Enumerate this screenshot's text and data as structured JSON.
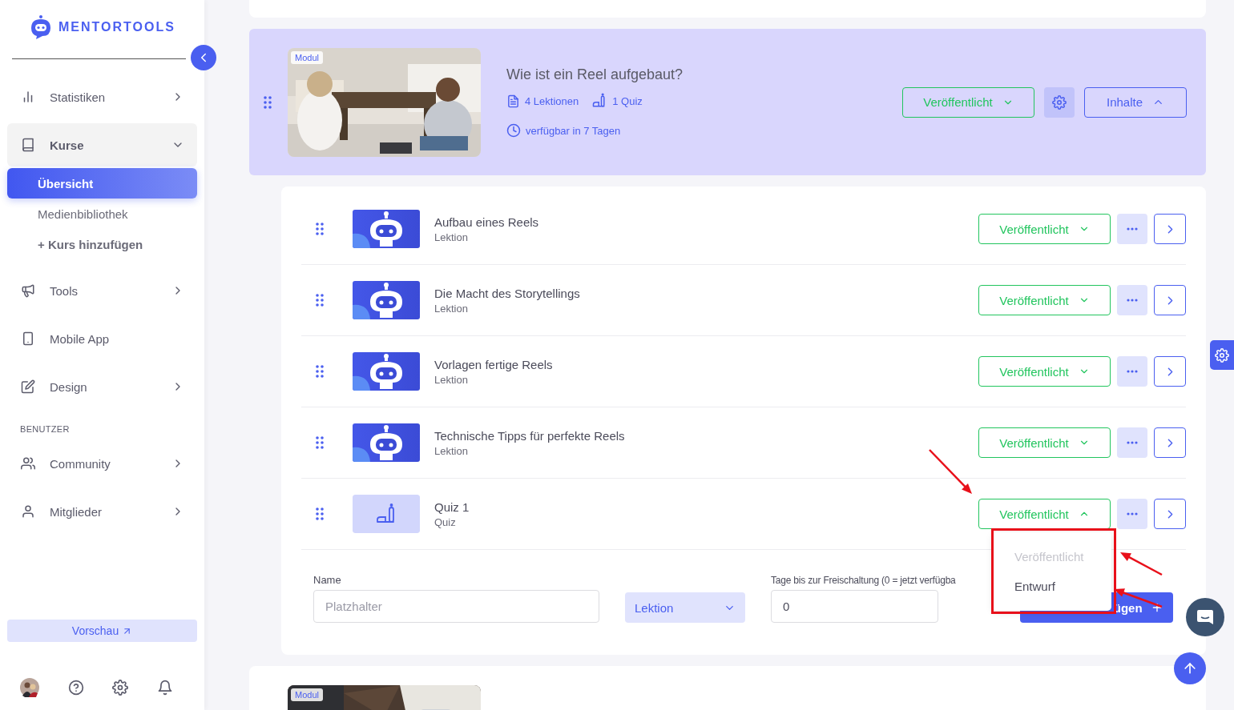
{
  "logo": {
    "text": "MENTORTOOLS"
  },
  "sidebar": {
    "items": [
      {
        "kind": "chart",
        "label": "Statistiken",
        "expandable": true,
        "expanded": false
      },
      {
        "kind": "book",
        "label": "Kurse",
        "expandable": true,
        "expanded": true,
        "children": [
          {
            "label": "Übersicht",
            "selected": true,
            "bold": false
          },
          {
            "label": "Medienbibliothek",
            "selected": false,
            "bold": false
          },
          {
            "label": "+ Kurs hinzufügen",
            "selected": false,
            "bold": true
          }
        ]
      },
      {
        "kind": "megaphone",
        "label": "Tools",
        "expandable": true,
        "expanded": false
      },
      {
        "kind": "phone",
        "label": "Mobile App",
        "expandable": false,
        "expanded": false
      },
      {
        "kind": "pen",
        "label": "Design",
        "expandable": true,
        "expanded": false
      },
      {
        "kind": "heading",
        "label": "BENUTZER"
      },
      {
        "kind": "people",
        "label": "Community",
        "expandable": true,
        "expanded": false
      },
      {
        "kind": "person",
        "label": "Mitglieder",
        "expandable": true,
        "expanded": false
      }
    ],
    "preview_button": "Vorschau"
  },
  "module": {
    "badge": "Modul",
    "title": "Wie ist ein Reel aufgebaut?",
    "lessons": "4 Lektionen",
    "quizzes": "1 Quiz",
    "availability": "verfügbar in 7 Tagen",
    "status": "Veröffentlicht",
    "contents_button": "Inhalte",
    "expanded": true
  },
  "rows": [
    {
      "kind": "lesson",
      "title": "Aufbau eines Reels",
      "type": "Lektion",
      "status": "Veröffentlicht",
      "menu_open": false
    },
    {
      "kind": "lesson",
      "title": "Die Macht des Storytellings",
      "type": "Lektion",
      "status": "Veröffentlicht",
      "menu_open": false
    },
    {
      "kind": "lesson",
      "title": "Vorlagen fertige Reels",
      "type": "Lektion",
      "status": "Veröffentlicht",
      "menu_open": false
    },
    {
      "kind": "lesson",
      "title": "Technische Tipps für perfekte Reels",
      "type": "Lektion",
      "status": "Veröffentlicht",
      "menu_open": false
    },
    {
      "kind": "quiz",
      "title": "Quiz 1",
      "type": "Quiz",
      "status": "Veröffentlicht",
      "menu_open": true,
      "menu": [
        {
          "label": "Veröffentlicht",
          "disabled": true
        },
        {
          "label": "Entwurf",
          "disabled": false
        }
      ]
    }
  ],
  "form": {
    "name_label": "Name",
    "name_placeholder": "Platzhalter",
    "type_select": "Lektion",
    "days_label": "Tage bis zur Freischaltung (0 = jetzt verfügba",
    "days_value": "0",
    "add_button": "ügen"
  },
  "next_module": {
    "badge": "Modul"
  }
}
